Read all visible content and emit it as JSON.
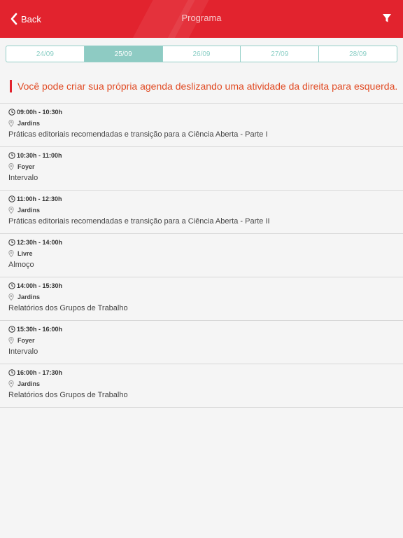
{
  "nav": {
    "back_label": "Back",
    "title": "Programa",
    "filter_icon": "filter-icon",
    "back_icon": "chevron-left-icon"
  },
  "date_tabs": [
    {
      "label": "24/09",
      "active": false
    },
    {
      "label": "25/09",
      "active": true
    },
    {
      "label": "26/09",
      "active": false
    },
    {
      "label": "27/09",
      "active": false
    },
    {
      "label": "28/09",
      "active": false
    }
  ],
  "hint": "Você pode criar sua própria agenda deslizando uma atividade da direita para esquerda.",
  "schedule": [
    {
      "time": "09:00h - 10:30h",
      "location": "Jardins",
      "title": "Práticas editoriais recomendadas e transição para a Ciência Aberta - Parte I"
    },
    {
      "time": "10:30h - 11:00h",
      "location": "Foyer",
      "title": "Intervalo"
    },
    {
      "time": "11:00h - 12:30h",
      "location": "Jardins",
      "title": "Práticas editoriais recomendadas e transição para a Ciência Aberta - Parte II"
    },
    {
      "time": "12:30h - 14:00h",
      "location": "Livre",
      "title": "Almoço"
    },
    {
      "time": "14:00h - 15:30h",
      "location": "Jardins",
      "title": "Relatórios dos Grupos de Trabalho"
    },
    {
      "time": "15:30h - 16:00h",
      "location": "Foyer",
      "title": "Intervalo"
    },
    {
      "time": "16:00h - 17:30h",
      "location": "Jardins",
      "title": "Relatórios dos Grupos de Trabalho"
    }
  ],
  "colors": {
    "brand": "#e2232e",
    "accent": "#8ecbc3",
    "hint": "#e14b24"
  }
}
